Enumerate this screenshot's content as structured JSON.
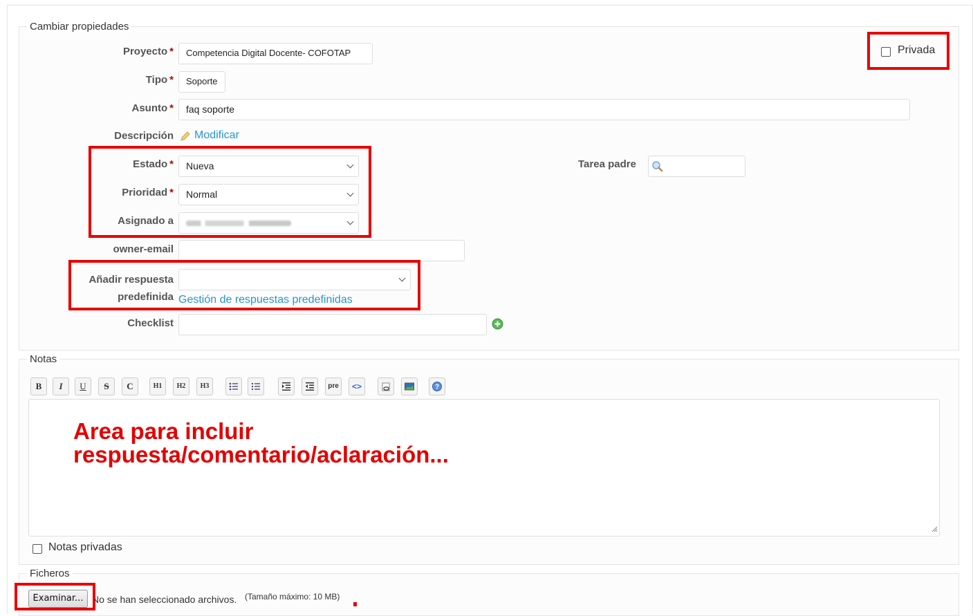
{
  "properties": {
    "legend": "Cambiar propiedades",
    "proyecto_label": "Proyecto",
    "proyecto_value": "Competencia Digital Docente- COFOTAP",
    "tipo_label": "Tipo",
    "tipo_value": "Soporte",
    "asunto_label": "Asunto",
    "asunto_value": "faq soporte",
    "descripcion_label": "Descripción",
    "modificar_link": "Modificar",
    "estado_label": "Estado",
    "estado_value": "Nueva",
    "prioridad_label": "Prioridad",
    "prioridad_value": "Normal",
    "asignado_label": "Asignado a",
    "owner_email_label": "owner-email",
    "respuesta_label_1": "Añadir respuesta",
    "respuesta_label_2": "predefinida",
    "gestion_link": "Gestión de respuestas predefinidas",
    "checklist_label": "Checklist",
    "tarea_padre_label": "Tarea padre",
    "privada_label": "Privada",
    "required_mark": "*"
  },
  "notes": {
    "legend": "Notas",
    "toolbar": [
      "B",
      "I",
      "U",
      "S",
      "C",
      "H1",
      "H2",
      "H3",
      "ul",
      "ol",
      "indent",
      "outdent",
      "pre",
      "<>",
      "link",
      "img",
      "help"
    ],
    "toolbar_pre": "pre",
    "annotation_line1": "Area para incluir",
    "annotation_line2": "respuesta/comentario/aclaración...",
    "private_notes_label": "Notas privadas"
  },
  "files": {
    "legend": "Ficheros",
    "browse_button": "Examinar...",
    "no_file_text": "No se han seleccionado archivos.",
    "max_size_text": "(Tamaño máximo: 10 MB)"
  },
  "colors": {
    "highlight": "#e80000",
    "link": "#2996cc",
    "required": "#bb0000"
  }
}
